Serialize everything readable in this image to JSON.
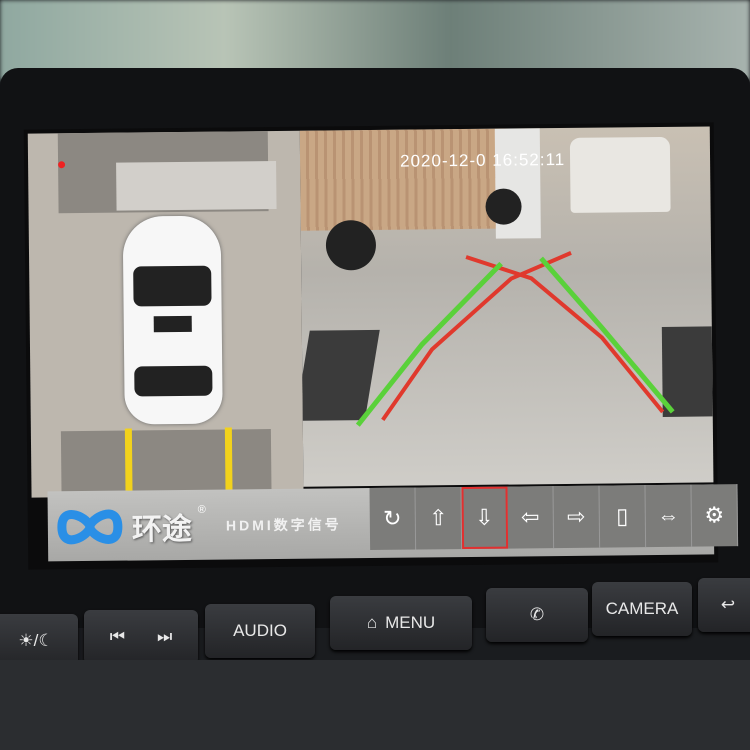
{
  "screen": {
    "timestamp": "2020-12-0  16:52:11",
    "colors": {
      "guide_green": "#5ad13a",
      "guide_red": "#e0392d",
      "marker_yellow": "#f2d21c",
      "selected_outline": "#e23030",
      "brand_blue": "#2a8fe6"
    },
    "toolbar": {
      "brand_name": "环途",
      "registered": "®",
      "subtitle": "HDMI数字信号",
      "tools": [
        {
          "icon": "rotate-icon",
          "glyph": "↻"
        },
        {
          "icon": "front-view-icon",
          "glyph": "⇧"
        },
        {
          "icon": "rear-view-icon",
          "glyph": "⇩",
          "selected": true
        },
        {
          "icon": "left-view-icon",
          "glyph": "⇦"
        },
        {
          "icon": "right-view-icon",
          "glyph": "⇨"
        },
        {
          "icon": "top-view-icon",
          "glyph": "▯"
        },
        {
          "icon": "wide-view-icon",
          "glyph": "⇔"
        },
        {
          "icon": "gear-icon",
          "glyph": "⚙"
        }
      ]
    }
  },
  "hardware_buttons": [
    {
      "label": "☀/☾",
      "icon": "day-night-icon"
    },
    {
      "label": "⏮",
      "icon": "previous-track-icon"
    },
    {
      "label": "⏭",
      "icon": "next-track-icon"
    },
    {
      "label": "AUDIO"
    },
    {
      "label": "MENU",
      "icon": "home-icon"
    },
    {
      "label": "✆",
      "icon": "phone-icon"
    },
    {
      "label": "CAMERA"
    },
    {
      "label": "↩",
      "icon": "back-icon"
    }
  ]
}
